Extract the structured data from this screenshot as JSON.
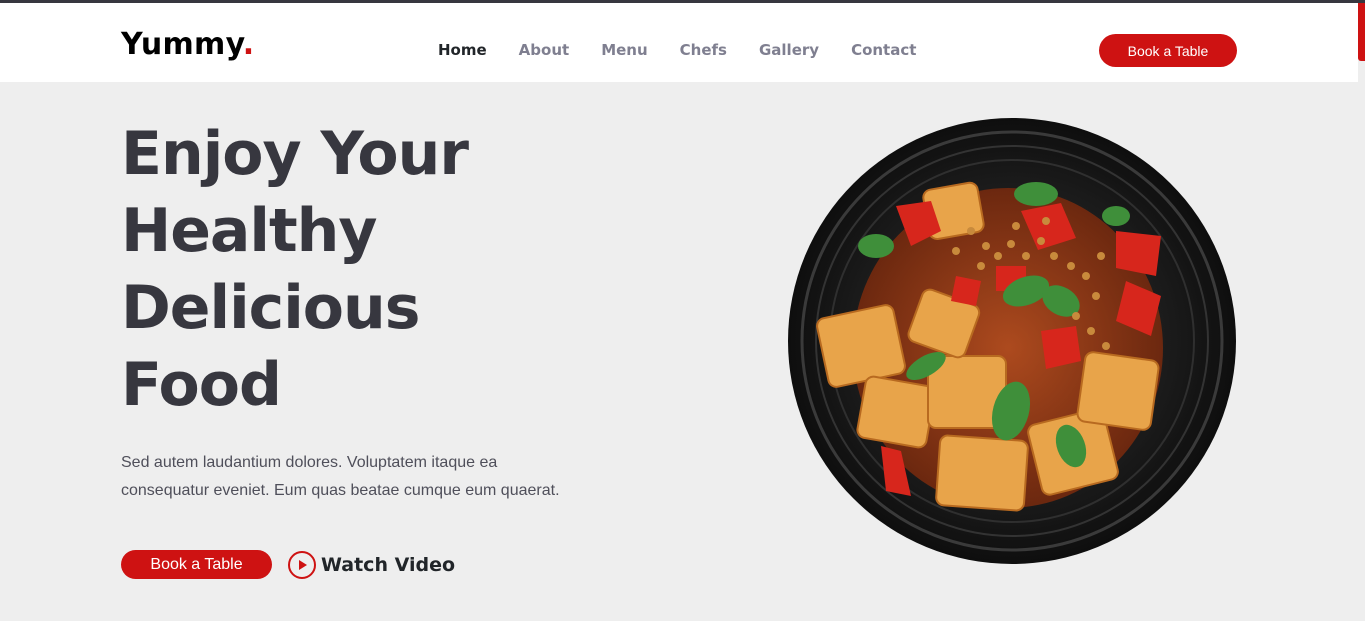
{
  "header": {
    "logo_text": "Yummy",
    "logo_dot": ".",
    "nav": [
      {
        "label": "Home",
        "active": true
      },
      {
        "label": "About"
      },
      {
        "label": "Menu"
      },
      {
        "label": "Chefs"
      },
      {
        "label": "Gallery"
      },
      {
        "label": "Contact"
      }
    ],
    "cta_label": "Book a Table"
  },
  "hero": {
    "title_lines": [
      "Enjoy Your",
      "Healthy",
      "Delicious",
      "Food"
    ],
    "description": "Sed autem laudantium dolores. Voluptatem itaque ea consequatur eveniet. Eum quas beatae cumque eum quaerat.",
    "book_label": "Book a Table",
    "watch_label": "Watch Video"
  },
  "colors": {
    "accent": "#ce1212",
    "heading": "#37373f",
    "background": "#eeeeee"
  },
  "icons": {
    "play": "play-circle-icon",
    "hero_image": "food-plate-image"
  }
}
